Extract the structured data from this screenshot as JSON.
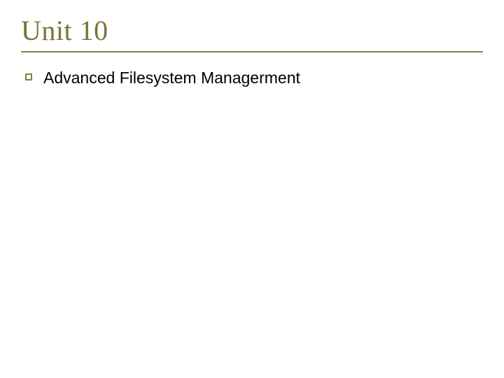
{
  "slide": {
    "title": "Unit 10",
    "bullets": [
      {
        "text": "Advanced Filesystem Managerment"
      }
    ]
  }
}
